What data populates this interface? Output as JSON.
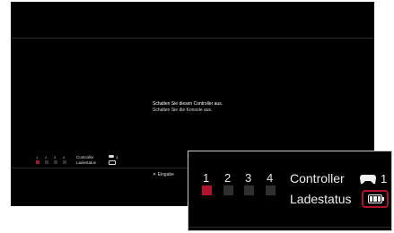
{
  "screen": {
    "message_line1": "Schalten Sie diesen Controller aus.",
    "message_line2": "Schalten Sie die Konsole aus.",
    "enter_hint": "✕ Eingabe"
  },
  "status": {
    "ports": [
      "1",
      "2",
      "3",
      "4"
    ],
    "active_port": "1",
    "controller_label": "Controller",
    "controller_number": "1",
    "charge_label": "Ladestatus",
    "battery_icon": "battery-full-icon",
    "controller_icon": "gamepad-icon"
  },
  "colors": {
    "active_port": "#b1132c",
    "highlight_ring": "#b1132c"
  }
}
